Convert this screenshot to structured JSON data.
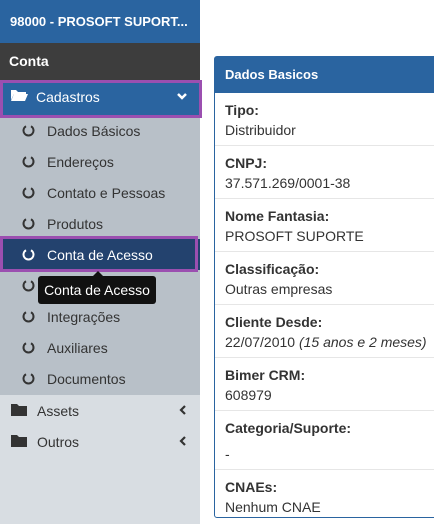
{
  "sidebar": {
    "brand": "98000 - PROSOFT SUPORT...",
    "section": "Conta",
    "group": {
      "label": "Cadastros",
      "icon": "folder-open-icon"
    },
    "items": [
      {
        "label": "Dados Básicos"
      },
      {
        "label": "Endereços"
      },
      {
        "label": "Contato e Pessoas"
      },
      {
        "label": "Produtos"
      },
      {
        "label": "Conta de Acesso",
        "active": true
      },
      {
        "label": ""
      },
      {
        "label": "Integrações"
      },
      {
        "label": "Auxiliares"
      },
      {
        "label": "Documentos"
      }
    ],
    "tooltip": "Conta de Acesso",
    "other_groups": [
      {
        "label": "Assets"
      },
      {
        "label": "Outros"
      }
    ]
  },
  "panel": {
    "title": "Dados Basicos",
    "fields": [
      {
        "label": "Tipo:",
        "value": "Distribuidor"
      },
      {
        "label": "CNPJ:",
        "value": "37.571.269/0001-38"
      },
      {
        "label": "Nome Fantasia:",
        "value": "PROSOFT SUPORTE"
      },
      {
        "label": "Classificação:",
        "value": "Outras empresas"
      },
      {
        "label": "Cliente Desde:",
        "value": "22/07/2010",
        "extra": "(15 anos e 2 meses)"
      },
      {
        "label": "Bimer CRM:",
        "value": "608979"
      },
      {
        "label": "Categoria/Suporte:",
        "value": "-"
      },
      {
        "label": "CNAEs:",
        "value": "Nenhum CNAE"
      }
    ]
  },
  "colors": {
    "brand": "#2a64a0",
    "active": "#23426e",
    "highlight": "#9b4fb0"
  }
}
